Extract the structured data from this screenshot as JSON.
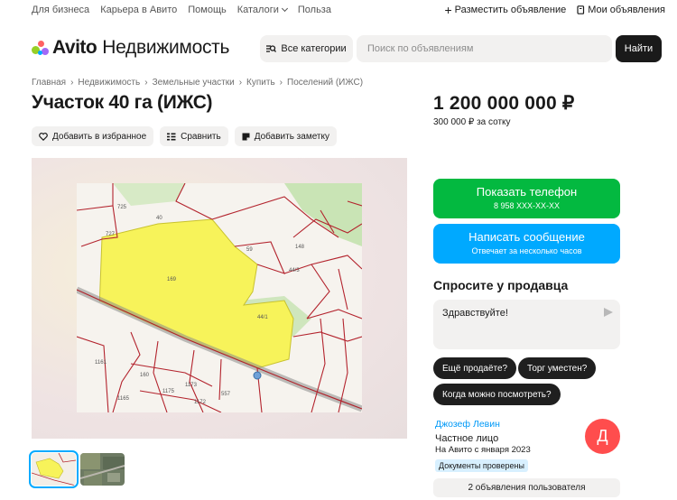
{
  "top_nav": {
    "links": [
      "Для бизнеса",
      "Карьера в Авито",
      "Помощь",
      "Каталоги",
      "Польза"
    ],
    "post_ad": "Разместить объявление",
    "my_ads": "Мои объявления"
  },
  "header": {
    "logo": "Avito",
    "section": "Недвижимость",
    "categories_label": "Все категории",
    "search_placeholder": "Поиск по объявлениям",
    "find_label": "Найти"
  },
  "breadcrumb": [
    "Главная",
    "Недвижимость",
    "Земельные участки",
    "Купить",
    "Поселений (ИЖС)"
  ],
  "listing": {
    "title": "Участок 40 га (ИЖС)",
    "price": "1 200 000 000 ₽",
    "price_per_unit": "300 000 ₽ за сотку"
  },
  "actions": {
    "favorite": "Добавить в избранное",
    "compare": "Сравнить",
    "note": "Добавить заметку"
  },
  "gallery": {
    "map_labels": [
      "725",
      "727",
      "40",
      "59",
      "44/3",
      "44/1",
      "148",
      "169",
      "557",
      "160",
      "1175",
      "1173",
      "1172",
      "1165",
      "1161"
    ],
    "thumbnail_count": 2
  },
  "contact": {
    "phone_label": "Показать телефон",
    "phone_masked": "8 958 XXX-XX-XX",
    "message_label": "Написать сообщение",
    "message_sub": "Отвечает за несколько часов"
  },
  "ask": {
    "heading": "Спросите у продавца",
    "message": "Здравствуйте!",
    "quick_questions": [
      "Ещё продаёте?",
      "Торг уместен?",
      "Когда можно посмотреть?"
    ]
  },
  "seller": {
    "name": "Джозеф Левин",
    "type": "Частное лицо",
    "since": "На Авито с января 2023",
    "verified_badge": "Документы проверены",
    "avatar_letter": "Д",
    "ads_count": "2 объявления пользователя"
  },
  "colors": {
    "green": "#03b940",
    "blue": "#00a9ff",
    "avatar": "#ff4d4d",
    "plot_yellow": "#f7f35a"
  }
}
